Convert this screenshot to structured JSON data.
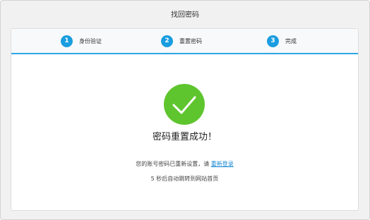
{
  "page": {
    "title": "找回密码"
  },
  "steps": [
    {
      "number": "1",
      "label": "身份验证"
    },
    {
      "number": "2",
      "label": "重置密码"
    },
    {
      "number": "3",
      "label": "完成"
    }
  ],
  "colors": {
    "accent_blue": "#1a9de0",
    "success_green": "#5fc52e",
    "link_blue": "#1a8ad4"
  },
  "result": {
    "icon": "check-circle-icon",
    "title": "密码重置成功！",
    "message_prefix": "您的账号密码已重新设置，请",
    "relogin_link": "重新登录",
    "redirect_notice": "5 秒后自动跳转到网站首页"
  }
}
